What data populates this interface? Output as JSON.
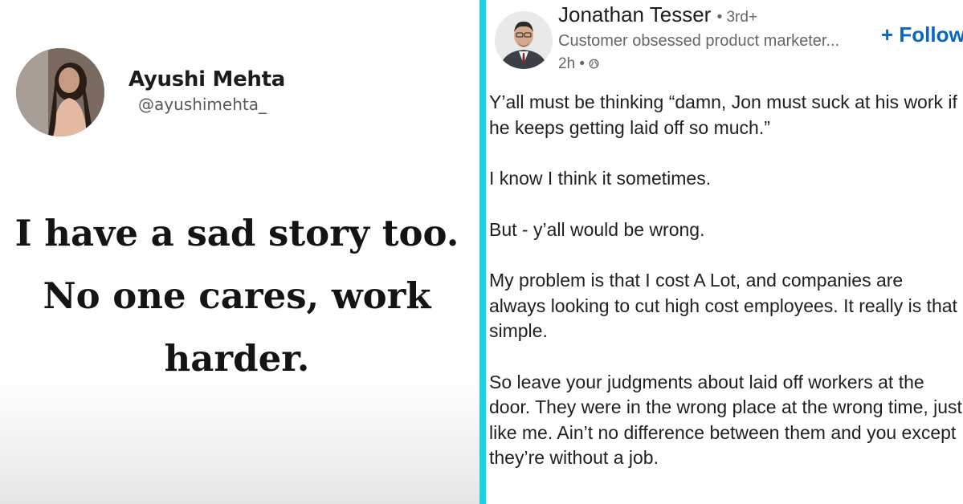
{
  "left_post": {
    "author_name": "Ayushi Mehta",
    "author_handle": "@ayushimehta_",
    "quote_lines": [
      "I have a sad story too.",
      "No one cares, work",
      "harder."
    ]
  },
  "right_post": {
    "poster_name": "Jonathan Tesser",
    "connection_degree": "• 3rd+",
    "headline": "Customer obsessed product marketer...",
    "time": "2h •",
    "follow_label": "+ Follow",
    "paragraphs": [
      "Y’all must be thinking “damn, Jon must suck at his work if he keeps getting laid off so much.”",
      "I know I think it sometimes.",
      "But - y’all would be wrong.",
      "My problem is that I cost A Lot, and companies are always looking to cut high cost employees. It really is that simple.",
      "So leave your judgments about laid off workers at the door. They were in the wrong place at the wrong time, just like me. Ain’t no difference between them and you except they’re without a job."
    ]
  },
  "colors": {
    "divider": "#17d4e6",
    "follow": "#0a66c2",
    "secondary_text": "#666666"
  },
  "icons": [
    "globe-icon"
  ]
}
